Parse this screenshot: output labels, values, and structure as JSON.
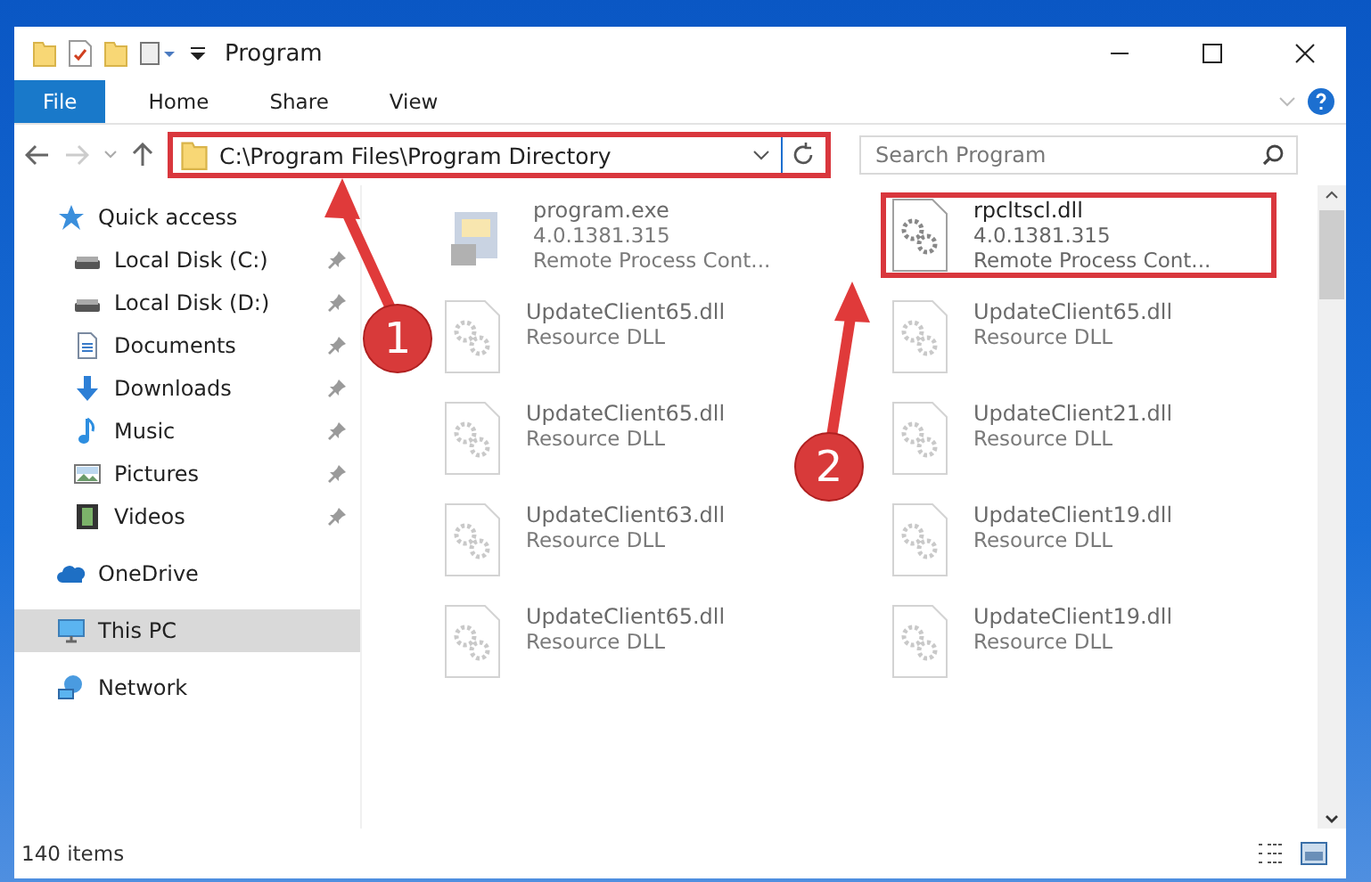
{
  "window": {
    "title": "Program"
  },
  "ribbon_tabs": [
    {
      "label": "File",
      "selected": true
    },
    {
      "label": "Home",
      "selected": false
    },
    {
      "label": "Share",
      "selected": false
    },
    {
      "label": "View",
      "selected": false
    }
  ],
  "address_bar": {
    "path": "C:\\Program Files\\Program Directory",
    "highlighted": true
  },
  "search": {
    "placeholder": "Search Program"
  },
  "sidebar": {
    "items": [
      {
        "label": "Quick access",
        "kind": "header",
        "selected": false
      },
      {
        "label": "Local Disk (C:)",
        "kind": "pinned",
        "selected": false
      },
      {
        "label": "Local Disk (D:)",
        "kind": "pinned",
        "selected": false
      },
      {
        "label": "Documents",
        "kind": "pinned",
        "selected": false
      },
      {
        "label": "Downloads",
        "kind": "pinned",
        "selected": false
      },
      {
        "label": "Music",
        "kind": "pinned",
        "selected": false
      },
      {
        "label": "Pictures",
        "kind": "pinned",
        "selected": false
      },
      {
        "label": "Videos",
        "kind": "pinned",
        "selected": false
      },
      {
        "label": "OneDrive",
        "kind": "header",
        "selected": false
      },
      {
        "label": "This PC",
        "kind": "header",
        "selected": true
      },
      {
        "label": "Network",
        "kind": "header",
        "selected": false
      }
    ]
  },
  "files": [
    {
      "name": "program.exe",
      "lines": [
        "4.0.1381.315",
        "Remote Process Cont..."
      ],
      "kind": "application",
      "faded": true,
      "highlighted": false
    },
    {
      "name": "rpcltscl.dll",
      "lines": [
        "4.0.1381.315",
        "Remote Process Cont..."
      ],
      "kind": "library",
      "faded": false,
      "highlighted": true
    },
    {
      "name": "UpdateClient65.dll",
      "lines": [
        "Resource DLL"
      ],
      "kind": "library",
      "faded": true,
      "highlighted": false
    },
    {
      "name": "UpdateClient65.dll",
      "lines": [
        "Resource DLL"
      ],
      "kind": "library",
      "faded": true,
      "highlighted": false
    },
    {
      "name": "UpdateClient65.dll",
      "lines": [
        "Resource DLL"
      ],
      "kind": "library",
      "faded": true,
      "highlighted": false
    },
    {
      "name": "UpdateClient21.dll",
      "lines": [
        "Resource DLL"
      ],
      "kind": "library",
      "faded": true,
      "highlighted": false
    },
    {
      "name": "UpdateClient63.dll",
      "lines": [
        "Resource DLL"
      ],
      "kind": "library",
      "faded": true,
      "highlighted": false
    },
    {
      "name": "UpdateClient19.dll",
      "lines": [
        "Resource DLL"
      ],
      "kind": "library",
      "faded": true,
      "highlighted": false
    },
    {
      "name": "UpdateClient65.dll",
      "lines": [
        "Resource DLL"
      ],
      "kind": "library",
      "faded": true,
      "highlighted": false
    },
    {
      "name": "UpdateClient19.dll",
      "lines": [
        "Resource DLL"
      ],
      "kind": "library",
      "faded": true,
      "highlighted": false
    }
  ],
  "annotations": [
    {
      "number": "1"
    },
    {
      "number": "2"
    }
  ],
  "status_bar": {
    "count": "140 items"
  }
}
